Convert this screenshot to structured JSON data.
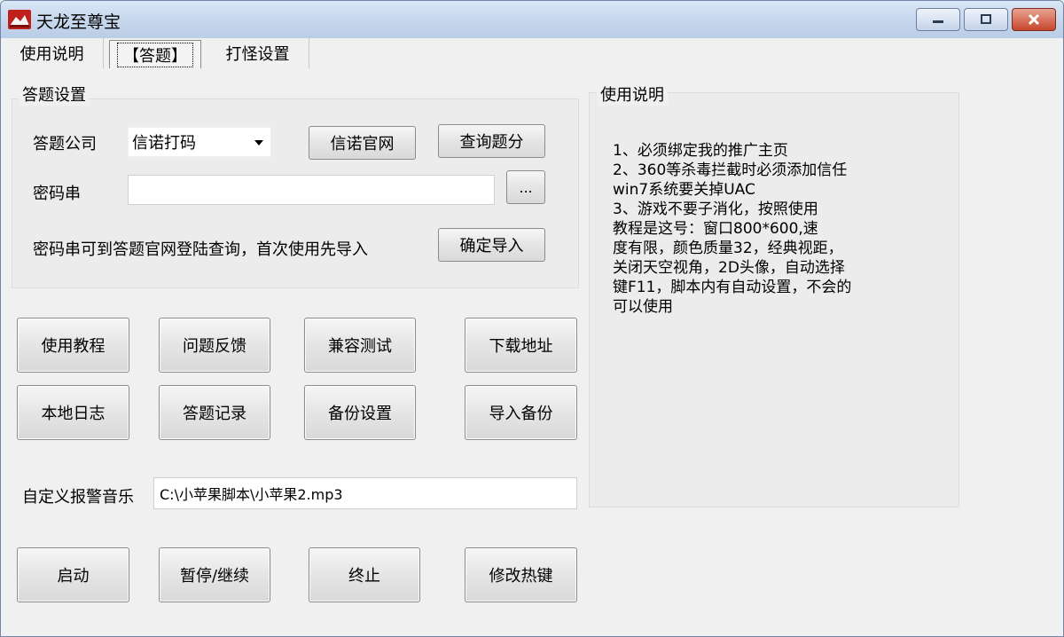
{
  "window": {
    "title": "天龙至尊宝",
    "icon": "app-logo-icon",
    "controls": [
      "minimize-icon",
      "maximize-icon",
      "close-icon"
    ]
  },
  "tabs": [
    {
      "label": "使用说明"
    },
    {
      "label": "【答题】"
    },
    {
      "label": "打怪设置"
    }
  ],
  "answer_settings": {
    "group_title": "答题设置",
    "company_label": "答题公司",
    "company_value": "信诺打码",
    "official_site_button": "信诺官网",
    "query_score_button": "查询题分",
    "password_label": "密码串",
    "password_value": "",
    "browse_button": "...",
    "hint": "密码串可到答题官网登陆查询，首次使用先导入",
    "import_button": "确定导入"
  },
  "actions_row1": [
    "使用教程",
    "问题反馈",
    "兼容测试",
    "下载地址"
  ],
  "actions_row2": [
    "本地日志",
    "答题记录",
    "备份设置",
    "导入备份"
  ],
  "alarm": {
    "label": "自定义报警音乐",
    "path": "C:\\小苹果脚本\\小苹果2.mp3"
  },
  "controls_row": [
    "启动",
    "暂停/继续",
    "终止",
    "修改热键"
  ],
  "instructions": {
    "group_title": "使用说明",
    "text": "1、必须绑定我的推广主页\n2、360等杀毒拦截时必须添加信任\nwin7系统要关掉UAC\n3、游戏不要子消化，按照使用\n教程是这号：窗口800*600,速\n度有限，颜色质量32，经典视距，\n关闭天空视角，2D头像，自动选择\n键F11，脚本内有自动设置，不会的\n可以使用"
  }
}
